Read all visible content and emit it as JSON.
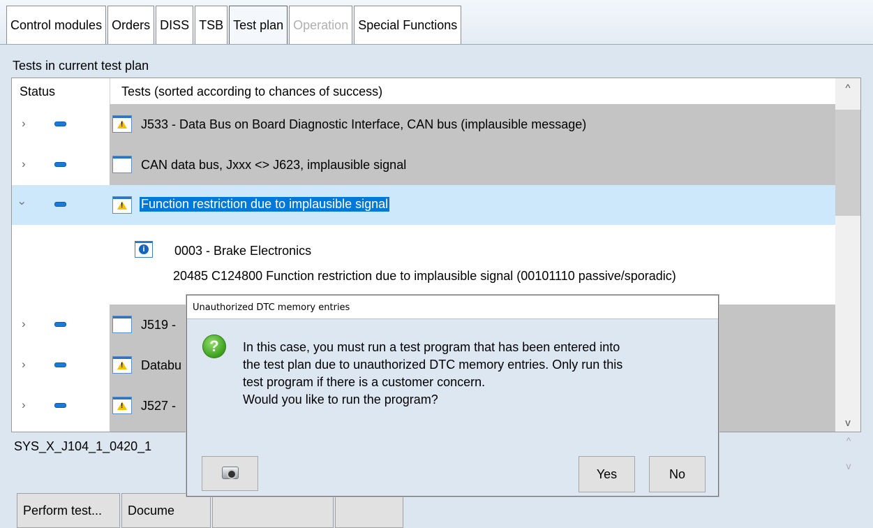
{
  "tabs": [
    {
      "label": "Control modules",
      "state": "normal"
    },
    {
      "label": "Orders",
      "state": "normal"
    },
    {
      "label": "DISS",
      "state": "normal"
    },
    {
      "label": "TSB",
      "state": "normal"
    },
    {
      "label": "Test plan",
      "state": "active"
    },
    {
      "label": "Operation",
      "state": "disabled"
    },
    {
      "label": "Special Functions",
      "state": "normal"
    }
  ],
  "section_title": "Tests in current test plan",
  "table": {
    "col_status": "Status",
    "col_tests": "Tests (sorted according to chances of success)",
    "rows": [
      {
        "text": "J533 - Data Bus on Board Diagnostic Interface, CAN bus (implausible message)",
        "icon": "warning-doc-icon",
        "expanded": false
      },
      {
        "text": "CAN data bus, Jxxx <> J623, implausible signal",
        "icon": "doc-icon",
        "expanded": false
      },
      {
        "text": "Function restriction due to implausible signal",
        "icon": "warning-doc-icon",
        "expanded": true,
        "selected": true
      },
      {
        "text": "J519 - ",
        "icon": "doc-icon",
        "expanded": false
      },
      {
        "text": "Databu",
        "icon": "warning-doc-icon",
        "expanded": false
      },
      {
        "text": "J527 - ",
        "icon": "warning-doc-icon",
        "expanded": false
      }
    ],
    "detail": {
      "module": "0003 - Brake Electronics",
      "line": "20485   C124800   Function restriction due to implausible signal  (00101110   passive/sporadic)"
    }
  },
  "bottom": {
    "name": "SYS_X_J104_1_0420_1"
  },
  "buttons": {
    "perform": "Perform test...",
    "document": "Docume"
  },
  "dialog": {
    "title": "Unauthorized DTC memory entries",
    "lines": [
      "In this case, you must run a test program that has been entered into",
      "the test plan due to unauthorized DTC memory entries. Only run this",
      "test program if there is a customer concern.",
      "Would you like to run the program?"
    ],
    "yes": "Yes",
    "no": "No"
  },
  "colors": {
    "selection": "#0078d7",
    "row_selected_bg": "#cde7fb",
    "row_gray": "#c4c4c4",
    "panel_bg": "#dce6f0"
  }
}
